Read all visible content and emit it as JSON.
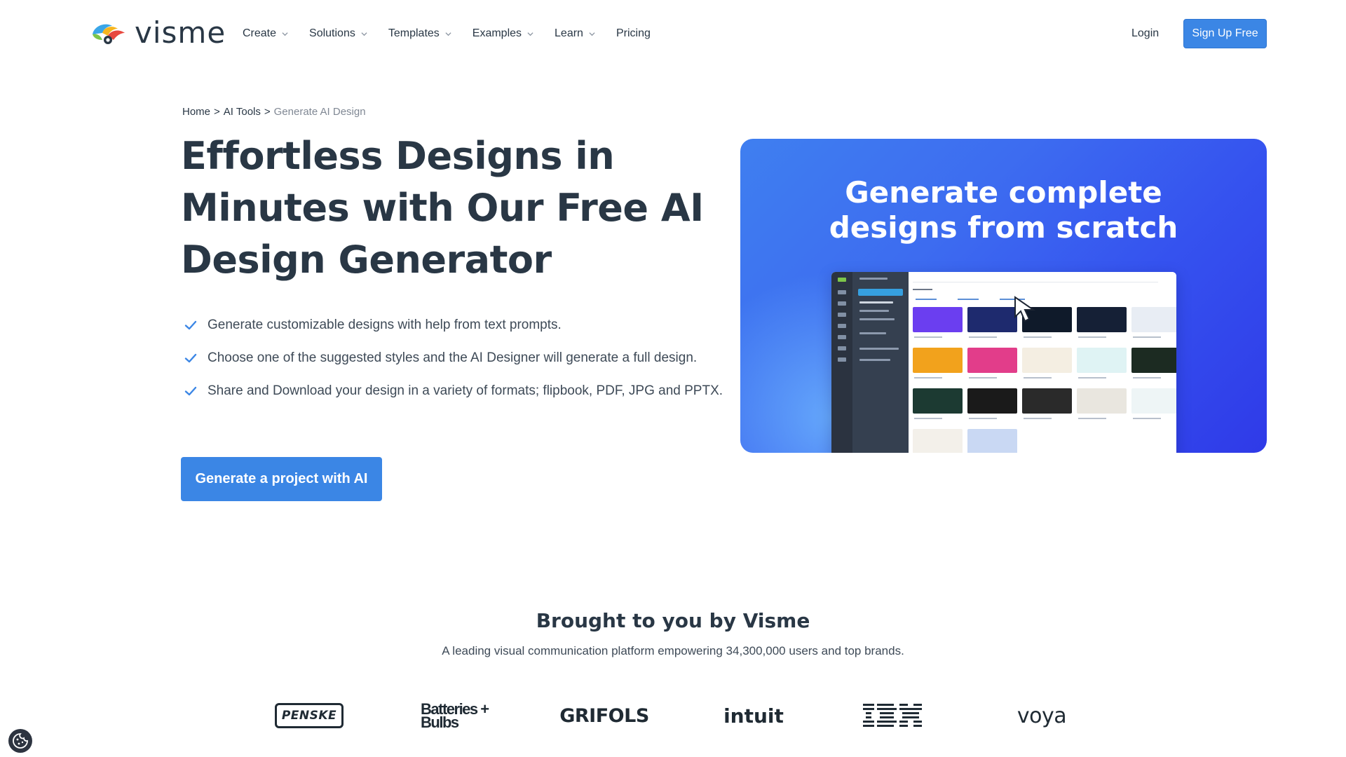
{
  "header": {
    "brand": "visme",
    "nav": [
      {
        "label": "Create",
        "has_dropdown": true
      },
      {
        "label": "Solutions",
        "has_dropdown": true
      },
      {
        "label": "Templates",
        "has_dropdown": true
      },
      {
        "label": "Examples",
        "has_dropdown": true
      },
      {
        "label": "Learn",
        "has_dropdown": true
      },
      {
        "label": "Pricing",
        "has_dropdown": false
      }
    ],
    "login_label": "Login",
    "signup_label": "Sign Up Free"
  },
  "breadcrumb": {
    "items": [
      "Home",
      "AI Tools"
    ],
    "separator": ">",
    "current": "Generate AI Design"
  },
  "hero": {
    "title": "Effortless Designs in Minutes with Our Free AI Design Generator",
    "features": [
      "Generate customizable designs with help from text prompts.",
      "Choose one of the suggested styles and the AI Designer will generate a full design.",
      "Share and Download your design in a variety of formats; flipbook, PDF, JPG and PPTX."
    ],
    "cta_label": "Generate a project with AI"
  },
  "promo": {
    "title_line1": "Generate complete",
    "title_line2": "designs from scratch"
  },
  "brands_section": {
    "title": "Brought to you by Visme",
    "subtitle": "A leading visual communication platform empowering 34,300,000 users and top brands.",
    "logos": [
      "PENSKE",
      "Batteries + Bulbs",
      "GRIFOLS",
      "intuit",
      "IBM",
      "voya"
    ]
  },
  "colors": {
    "primary": "#3b86e5",
    "text_dark": "#293745",
    "promo_gradient_start": "#3f7ff0",
    "promo_gradient_end": "#2f3ae8"
  },
  "icons": {
    "logo": "visme-chameleon-logo",
    "dropdown": "chevron-down-icon",
    "feature_bullet": "check-icon",
    "cookie": "cookie-icon"
  }
}
